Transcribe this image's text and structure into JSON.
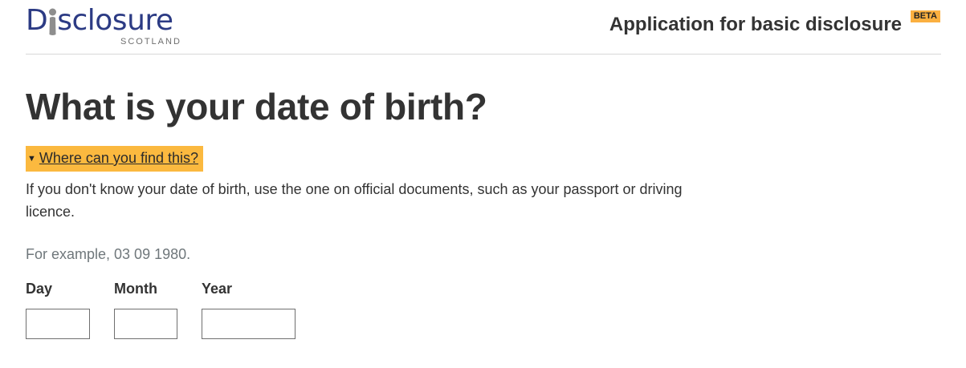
{
  "header": {
    "logo": {
      "word_before": "D",
      "word_after": "sclosure",
      "subtitle": "SCOTLAND"
    },
    "service_name": "Application for basic disclosure",
    "phase_badge": "BETA"
  },
  "main": {
    "title": "What is your date of birth?",
    "details": {
      "summary": "Where can you find this?",
      "body": "If you don't know your date of birth, use the one on official documents, such as your passport or driving licence."
    },
    "hint": "For example, 03 09 1980.",
    "date_fields": [
      {
        "label": "Day",
        "value": ""
      },
      {
        "label": "Month",
        "value": ""
      },
      {
        "label": "Year",
        "value": ""
      }
    ]
  },
  "colors": {
    "logo_blue": "#2c3b84",
    "badge_yellow": "#fbb040",
    "focus_yellow": "#fbb93f",
    "text": "#333333",
    "hint_grey": "#6f777b"
  }
}
